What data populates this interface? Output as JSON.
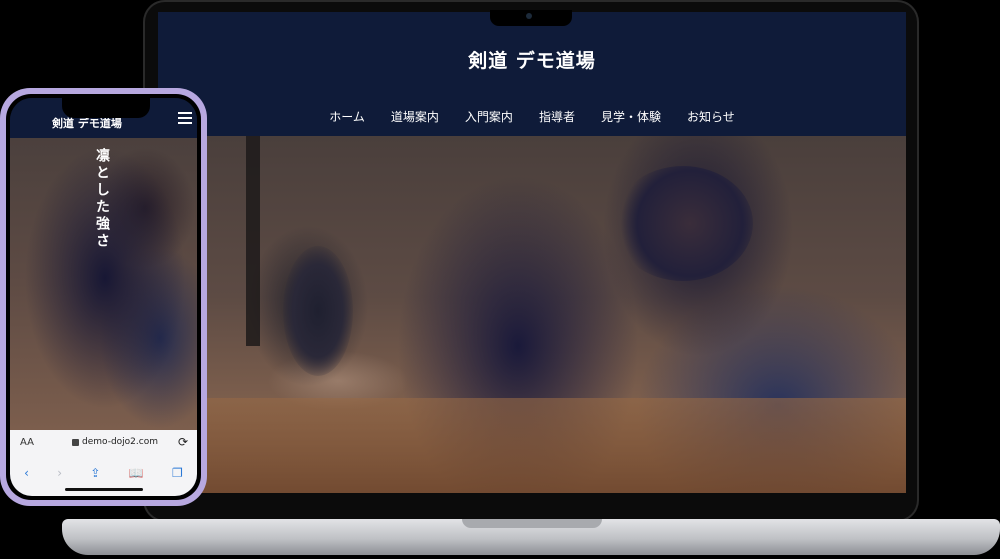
{
  "laptop": {
    "site_title": "剣道 デモ道場",
    "nav": [
      "ホーム",
      "道場案内",
      "入門案内",
      "指導者",
      "見学・体験",
      "お知らせ"
    ]
  },
  "phone": {
    "site_title": "剣道 デモ道場",
    "catch_copy": "凛とした強さ",
    "browser": {
      "aa_label": "AA",
      "url": "demo-dojo2.com",
      "reload_icon": "⟳",
      "back_icon": "‹",
      "forward_icon": "›",
      "share_icon": "⇪",
      "bookmarks_icon": "📖",
      "tabs_icon": "❐"
    }
  },
  "colors": {
    "header_bg": "#0f1b39",
    "phone_frame": "#b7a8e0",
    "safari_blue": "#2a78d6"
  }
}
